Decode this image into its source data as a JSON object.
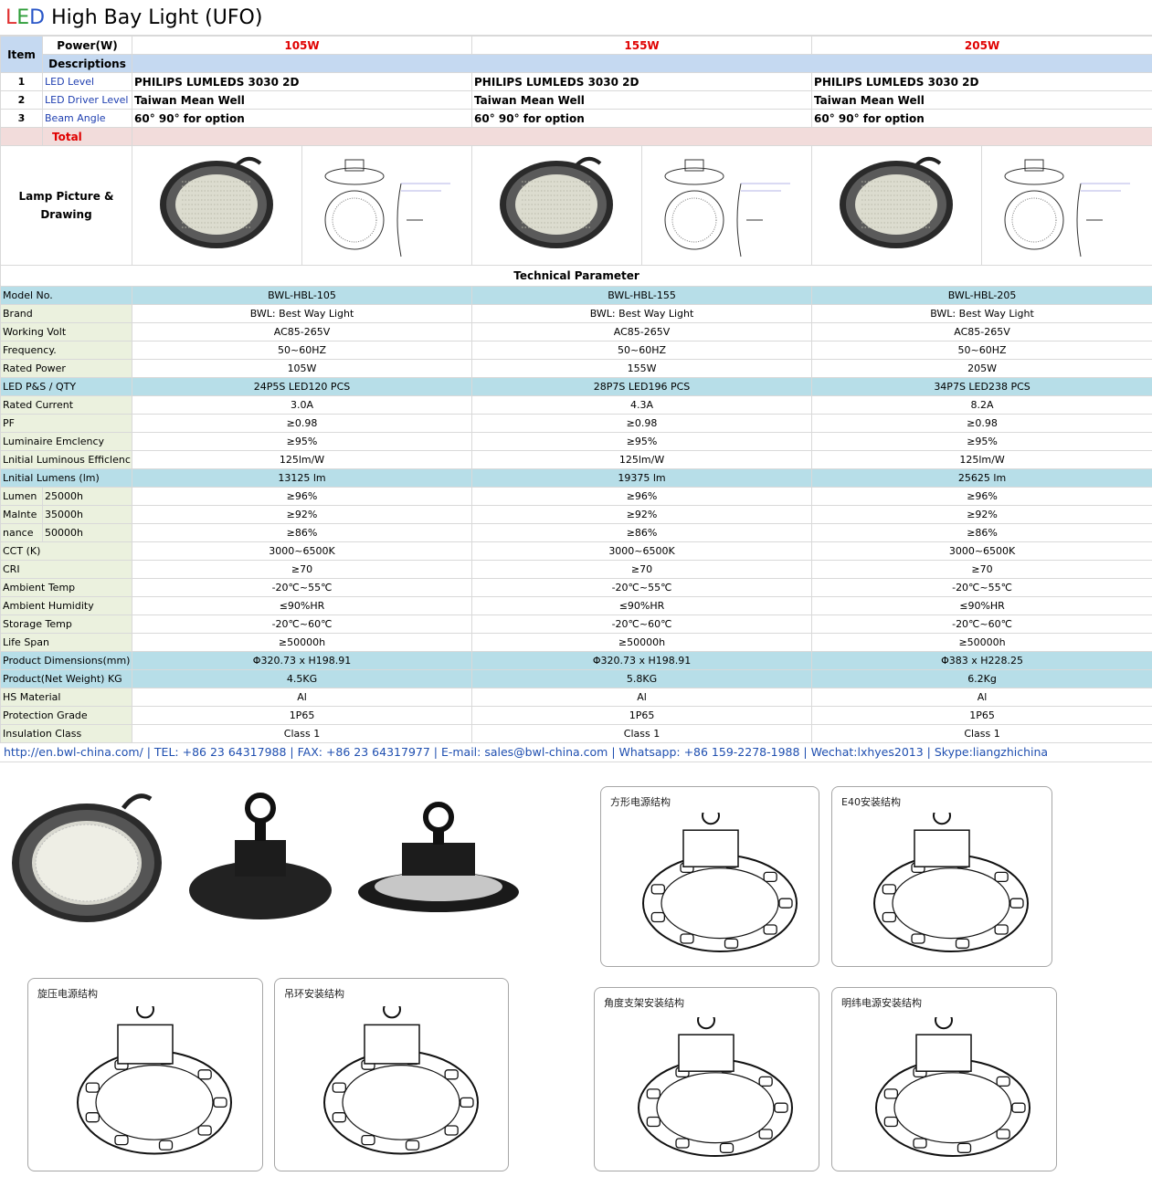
{
  "title": {
    "l": "L",
    "e": "E",
    "d": "D",
    "rest": " High Bay Light (UFO)"
  },
  "header": {
    "item": "Item",
    "power": "Power(W)",
    "descriptions": "Descriptions",
    "models": [
      "105W",
      "155W",
      "205W"
    ]
  },
  "desc_rows": [
    {
      "num": "1",
      "label": "LED Level",
      "values": [
        "PHILIPS LUMLEDS 3030 2D",
        "PHILIPS LUMLEDS 3030 2D",
        "PHILIPS LUMLEDS 3030 2D"
      ]
    },
    {
      "num": "2",
      "label": "LED Driver Level",
      "values": [
        "Taiwan Mean Well",
        "Taiwan Mean Well",
        "Taiwan Mean Well"
      ]
    },
    {
      "num": "3",
      "label": "Beam Angle",
      "values": [
        "60°  90° for option",
        "60°  90° for option",
        "60°  90° for option"
      ]
    }
  ],
  "total": "Total",
  "lamp_label": "Lamp Picture & Drawing",
  "tech_title": "Technical Parameter",
  "specs": [
    {
      "label": "Model No.",
      "values": [
        "BWL-HBL-105",
        "BWL-HBL-155",
        "BWL-HBL-205"
      ],
      "hl": true
    },
    {
      "label": "Brand",
      "values": [
        "BWL: Best Way Light",
        "BWL: Best Way Light",
        "BWL: Best Way Light"
      ]
    },
    {
      "label": "Working Volt",
      "values": [
        "AC85-265V",
        "AC85-265V",
        "AC85-265V"
      ]
    },
    {
      "label": "Frequency.",
      "values": [
        "50~60HZ",
        "50~60HZ",
        "50~60HZ"
      ]
    },
    {
      "label": "Rated Power",
      "values": [
        "105W",
        "155W",
        "205W"
      ]
    },
    {
      "label": "LED P&S / QTY",
      "values": [
        "24P5S  LED120 PCS",
        "28P7S LED196 PCS",
        "34P7S LED238 PCS"
      ],
      "hl": true
    },
    {
      "label": "Rated Current",
      "values": [
        "3.0A",
        "4.3A",
        "8.2A"
      ]
    },
    {
      "label": "PF",
      "values": [
        "≥0.98",
        "≥0.98",
        "≥0.98"
      ]
    },
    {
      "label": "Luminaire Emclency",
      "values": [
        "≥95%",
        "≥95%",
        "≥95%"
      ]
    },
    {
      "label": "Lnitial Luminous Efficlenc",
      "values": [
        "125lm/W",
        "125lm/W",
        "125lm/W"
      ]
    },
    {
      "label": "Lnitial Lumens (lm)",
      "values": [
        "13125 lm",
        "19375 lm",
        "25625 lm"
      ],
      "hl": true
    }
  ],
  "maintenance": {
    "labels": [
      "Lumen",
      "Malnte",
      "nance"
    ],
    "hours": [
      "25000h",
      "35000h",
      "50000h"
    ],
    "values": [
      [
        "≥96%",
        "≥96%",
        "≥96%"
      ],
      [
        "≥92%",
        "≥92%",
        "≥92%"
      ],
      [
        "≥86%",
        "≥86%",
        "≥86%"
      ]
    ]
  },
  "specs2": [
    {
      "label": "CCT (K)",
      "values": [
        "3000~6500K",
        "3000~6500K",
        "3000~6500K"
      ]
    },
    {
      "label": "CRI",
      "values": [
        "≥70",
        "≥70",
        "≥70"
      ]
    },
    {
      "label": "Ambient Temp",
      "values": [
        "-20℃~55℃",
        "-20℃~55℃",
        "-20℃~55℃"
      ]
    },
    {
      "label": "Ambient Humidity",
      "values": [
        "≤90%HR",
        "≤90%HR",
        "≤90%HR"
      ]
    },
    {
      "label": "Storage Temp",
      "values": [
        "-20℃~60℃",
        "-20℃~60℃",
        "-20℃~60℃"
      ]
    },
    {
      "label": "Life Span",
      "values": [
        "≥50000h",
        "≥50000h",
        "≥50000h"
      ]
    },
    {
      "label": "Product Dimensions(mm)",
      "values": [
        "Φ320.73 x H198.91",
        "Φ320.73 x H198.91",
        "Φ383 x H228.25"
      ],
      "hl": true
    },
    {
      "label": "Product(Net Weight) KG",
      "values": [
        "4.5KG",
        "5.8KG",
        "6.2Kg"
      ],
      "hl": true
    },
    {
      "label": "HS Material",
      "values": [
        "Al",
        "Al",
        "Al"
      ]
    },
    {
      "label": "Protection Grade",
      "values": [
        "1P65",
        "1P65",
        "1P65"
      ]
    },
    {
      "label": "Insulation Class",
      "values": [
        "Class 1",
        "Class 1",
        "Class 1"
      ]
    }
  ],
  "contact": "http://en.bwl-china.com/  |  TEL: +86 23 64317988   |  FAX: +86 23 64317977  |  E-mail: sales@bwl-china.com | Whatsapp: +86 159-2278-1988  | Wechat:lxhyes2013 | Skype:liangzhichina",
  "cards": {
    "square": "方形电源结构",
    "e40": "E40安装结构",
    "spin": "旋压电源结构",
    "ring": "吊环安装结构",
    "bracket": "角度支架安装结构",
    "exposed": "明纬电源安装结构"
  },
  "colors": {
    "desc_row": "#c5d9f1",
    "total_row": "#f2dcdb",
    "highlight": "#b7dee8",
    "label_bg": "#ebf1de",
    "red": "#e00000",
    "blue": "#1f3fb0"
  }
}
